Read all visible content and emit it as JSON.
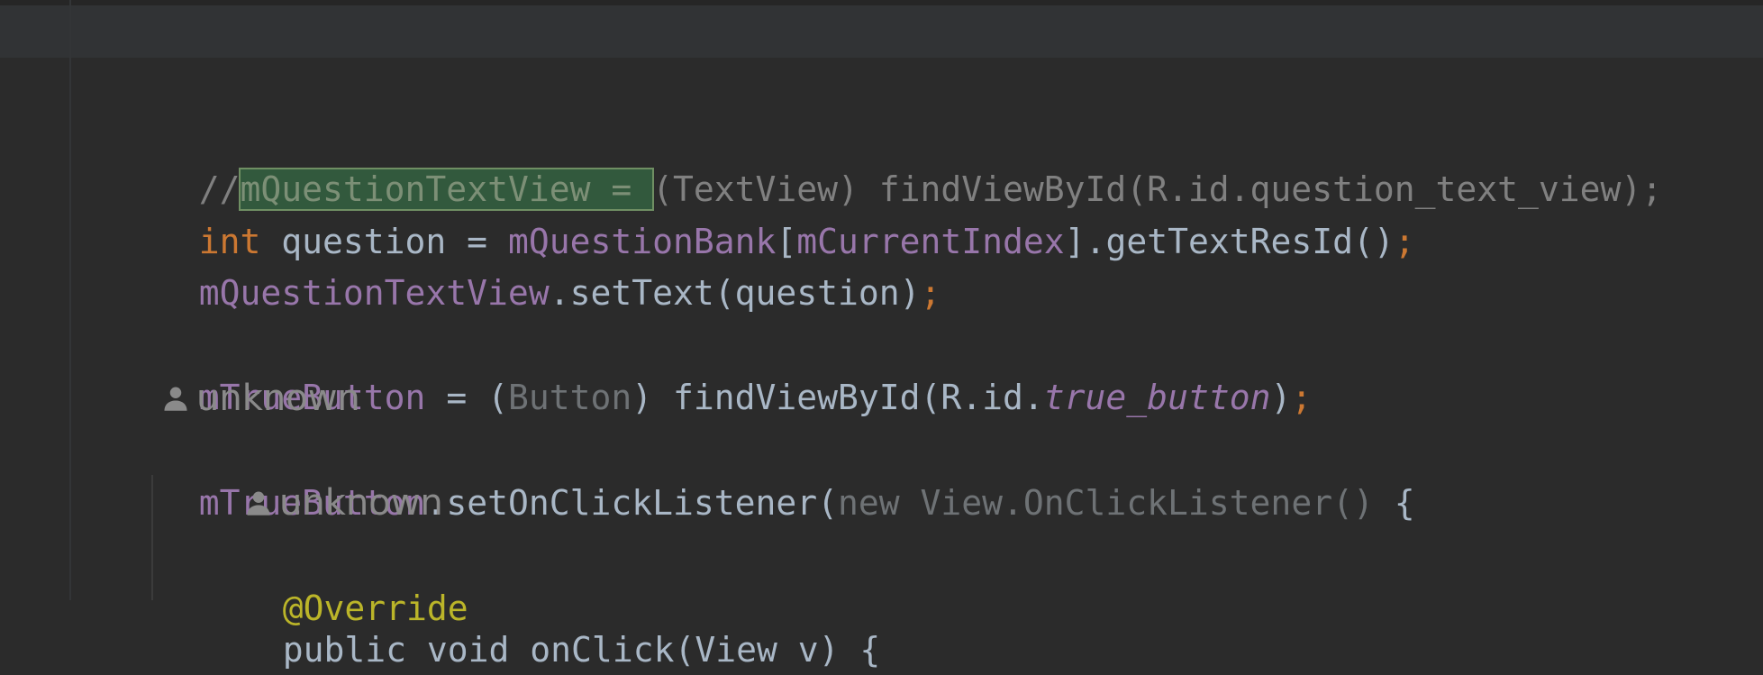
{
  "editor": {
    "line1": {
      "comment_prefix": "//",
      "selected_text": "mQuestionTextView = ",
      "rest": "(TextView) findViewById(R.id.question_text_view);"
    },
    "line2": {
      "kw": "int",
      "plain1": " question = ",
      "field1": "mQuestionBank",
      "bracket_open": "[",
      "field2": "mCurrentIndex",
      "rest": "].getTextResId()",
      "semi": ";"
    },
    "line3": {
      "field": "mQuestionTextView",
      "rest": ".setText(question)",
      "semi": ";"
    },
    "line5": {
      "field": "mTrueButton",
      "plain1": " = (",
      "cast": "Button",
      "plain2": ") findViewById(R.id.",
      "italic": "true_button",
      "close": ")",
      "semi": ";"
    },
    "inlay1": {
      "icon": "person-icon",
      "text": "unknown"
    },
    "line7": {
      "field": "mTrueButton",
      "plain1": ".setOnClickListener(",
      "dim": "new View.OnClickListener()",
      "brace": " {"
    },
    "inlay2": {
      "icon": "person-icon",
      "text": "unknown"
    },
    "line9": {
      "annotation": "@Override"
    },
    "line10": {
      "text": "public void onClick(View v) {"
    }
  }
}
